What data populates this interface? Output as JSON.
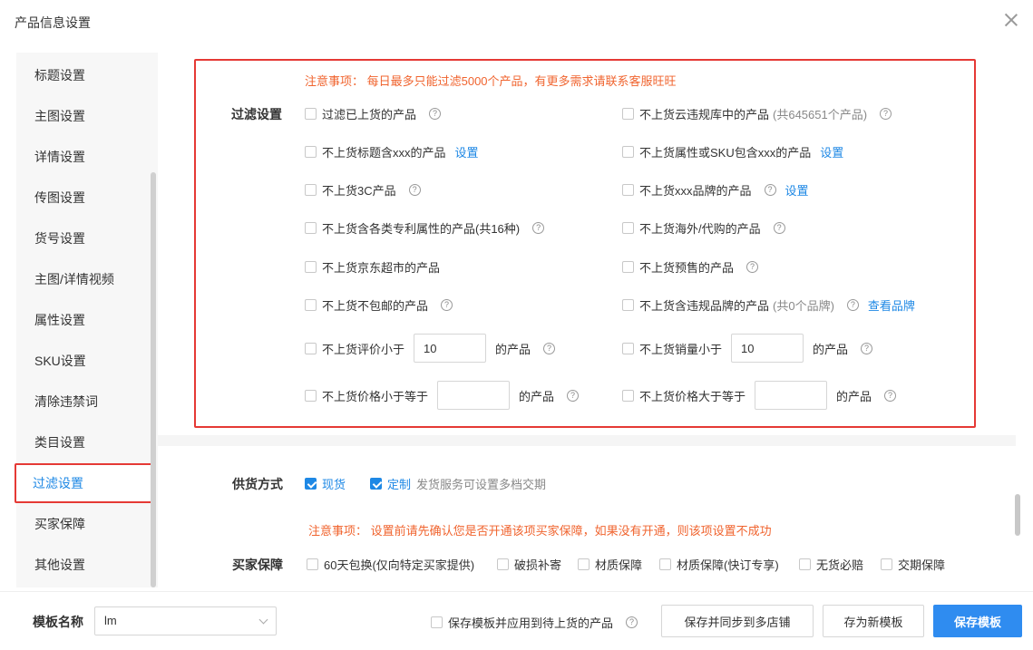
{
  "dialog": {
    "title": "产品信息设置"
  },
  "sidebar": {
    "items": [
      {
        "label": "标题设置"
      },
      {
        "label": "主图设置"
      },
      {
        "label": "详情设置"
      },
      {
        "label": "传图设置"
      },
      {
        "label": "货号设置"
      },
      {
        "label": "主图/详情视频"
      },
      {
        "label": "属性设置"
      },
      {
        "label": "SKU设置"
      },
      {
        "label": "清除违禁词"
      },
      {
        "label": "类目设置"
      },
      {
        "label": "过滤设置"
      },
      {
        "label": "买家保障"
      },
      {
        "label": "其他设置"
      }
    ],
    "active_index": 10
  },
  "filter": {
    "note": "注意事项： 每日最多只能过滤5000个产品，有更多需求请联系客服旺旺",
    "label": "过滤设置",
    "o1": {
      "label": "过滤已上货的产品"
    },
    "o2": {
      "label": "不上货云违规库中的产品",
      "muted": "(共645651个产品)"
    },
    "o3": {
      "label": "不上货标题含xxx的产品",
      "link": "设置"
    },
    "o4": {
      "label": "不上货属性或SKU包含xxx的产品",
      "link": "设置"
    },
    "o5": {
      "label": "不上货3C产品"
    },
    "o6": {
      "label": "不上货xxx品牌的产品",
      "link": "设置"
    },
    "o7": {
      "label": "不上货含各类专利属性的产品(共16种)"
    },
    "o8": {
      "label": "不上货海外/代购的产品"
    },
    "o9": {
      "label": "不上货京东超市的产品"
    },
    "o10": {
      "label": "不上货预售的产品"
    },
    "o11": {
      "label": "不上货不包邮的产品"
    },
    "o12": {
      "label": "不上货含违规品牌的产品",
      "muted": "(共0个品牌)",
      "link": "查看品牌"
    },
    "o13": {
      "label": "不上货评价小于",
      "value": "10",
      "suffix": "的产品"
    },
    "o14": {
      "label": "不上货销量小于",
      "value": "10",
      "suffix": "的产品"
    },
    "o15": {
      "label": "不上货价格小于等于",
      "value": "",
      "suffix": "的产品"
    },
    "o16": {
      "label": "不上货价格大于等于",
      "value": "",
      "suffix": "的产品"
    }
  },
  "supply": {
    "label": "供货方式",
    "spot": "现货",
    "custom": "定制",
    "custom_hint": "发货服务可设置多档交期"
  },
  "guarantee": {
    "note": "注意事项： 设置前请先确认您是否开通该项买家保障，如果没有开通，则该项设置不成功",
    "label": "买家保障",
    "items": [
      {
        "label": "60天包换(仅向特定买家提供)"
      },
      {
        "label": "破损补寄"
      },
      {
        "label": "材质保障"
      },
      {
        "label": "材质保障(快订专享)"
      },
      {
        "label": "无货必赔"
      },
      {
        "label": "交期保障"
      }
    ]
  },
  "footer": {
    "template_label": "模板名称",
    "template_value": "lm",
    "apply_label": "保存模板并应用到待上货的产品",
    "sync_button": "保存并同步到多店铺",
    "new_button": "存为新模板",
    "save_button": "保存模板"
  },
  "icons": {
    "help": "help-circle-icon",
    "close": "close-icon",
    "chevron": "chevron-down-icon",
    "check": "check-icon"
  },
  "colors": {
    "accent": "#1e88e5",
    "warning": "#f0642f",
    "highlight": "#e53935",
    "primary_button": "#2f8cf0"
  }
}
